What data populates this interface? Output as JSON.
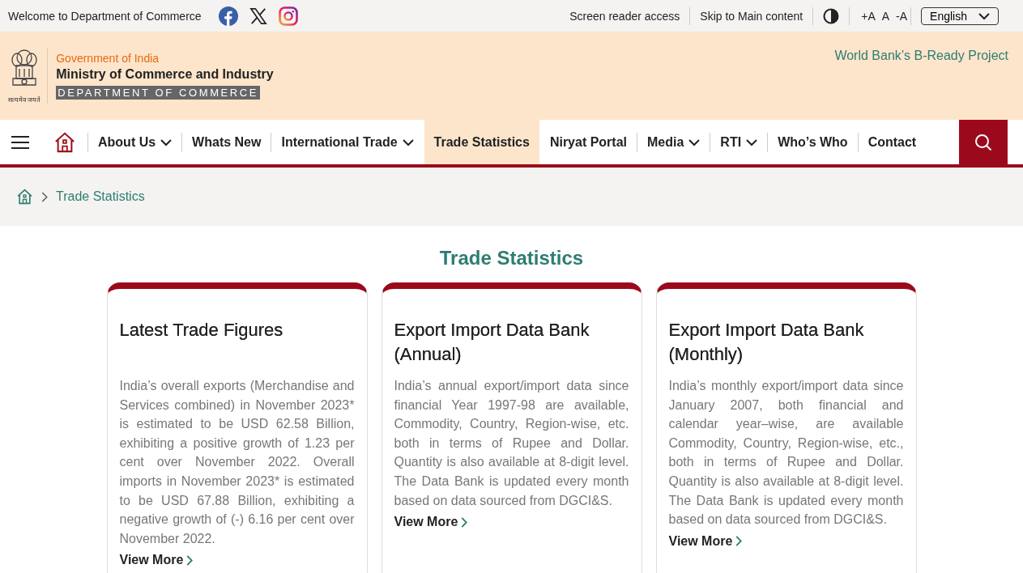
{
  "top_bar": {
    "welcome": "Welcome to Department of Commerce",
    "links": [
      "Screen reader access",
      "Skip to Main content"
    ],
    "font_sizes": [
      "+A",
      "A",
      "-A"
    ],
    "language": "English"
  },
  "header": {
    "government": "Government of India",
    "ministry": "Ministry of Commerce and Industry",
    "department": "DEPARTMENT OF COMMERCE",
    "emblem_motto": "सत्यमेव जयते",
    "project_link": "World Bank’s B-Ready Project"
  },
  "nav": {
    "items": [
      {
        "label": "About Us",
        "has_menu": true,
        "selected": false
      },
      {
        "label": "Whats New",
        "has_menu": false,
        "selected": false
      },
      {
        "label": "International Trade",
        "has_menu": true,
        "selected": false
      },
      {
        "label": "Trade Statistics",
        "has_menu": false,
        "selected": true
      },
      {
        "label": "Niryat Portal",
        "has_menu": false,
        "selected": false
      },
      {
        "label": "Media",
        "has_menu": true,
        "selected": false
      },
      {
        "label": "RTI",
        "has_menu": true,
        "selected": false
      },
      {
        "label": "Who’s Who",
        "has_menu": false,
        "selected": false
      },
      {
        "label": "Contact",
        "has_menu": false,
        "selected": false
      }
    ]
  },
  "breadcrumb": {
    "current": "Trade Statistics"
  },
  "page_title": "Trade Statistics",
  "cards": [
    {
      "title": "Latest Trade Figures",
      "text": "India’s overall exports (Merchandise and Services combined) in November 2023* is estimated to be USD 62.58 Billion, exhibiting a positive growth of 1.23 per cent over November 2022. Overall imports in November 2023* is estimated to be USD 67.88 Billion, exhibiting a negative growth of (-) 6.16 per cent over November 2022.",
      "link": "View More"
    },
    {
      "title": "Export Import Data Bank (Annual)",
      "text": "India’s annual export/import data since financial Year 1997-98 are available, Commodity, Country, Region-wise, etc. both in terms of Rupee and Dollar. Quantity is also available at 8-digit level. The Data Bank is updated every month based on data sourced from DGCI&S.",
      "link": "View More"
    },
    {
      "title": "Export Import Data Bank (Monthly)",
      "text": "India’s monthly export/import data since January 2007, both financial and calendar year–wise, are available Commodity, Country, Region-wise, etc., both in terms of Rupee and Dollar. Quantity is also available at 8-digit level. The Data Bank is updated every month based on data sourced from DGCI&S.",
      "link": "View More"
    }
  ]
}
